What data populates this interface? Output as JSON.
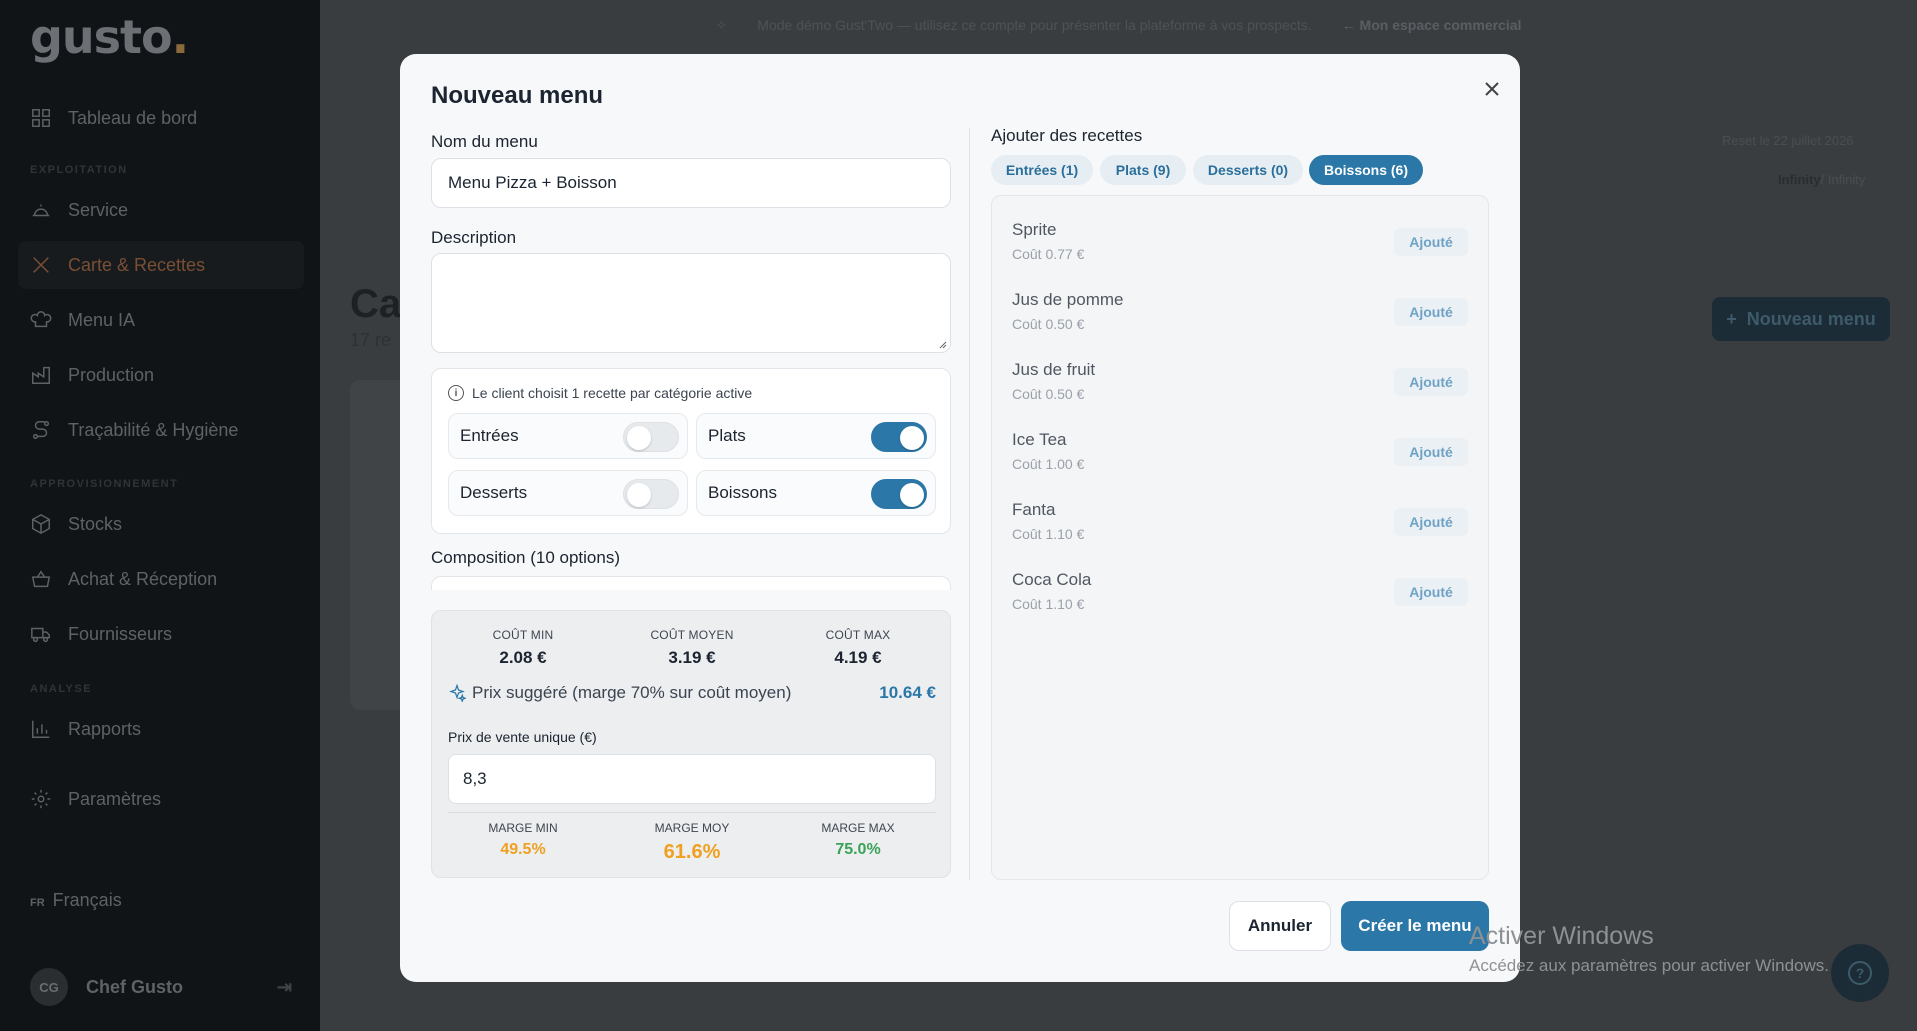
{
  "app": {
    "logo": "gusto",
    "topbar": {
      "notice": "Mode démo Gust'Two — utilisez ce compte pour présenter la plateforme à vos prospects.",
      "back_link": "← Mon espace commercial"
    },
    "sidebar": {
      "items": [
        {
          "label": "Tableau de bord",
          "icon": "grid-icon"
        },
        {
          "label": "Service",
          "icon": "cloche-icon"
        },
        {
          "label": "Carte & Recettes",
          "icon": "utensils-icon"
        },
        {
          "label": "Menu IA",
          "icon": "chef-hat-icon"
        },
        {
          "label": "Production",
          "icon": "factory-icon"
        },
        {
          "label": "Traçabilité & Hygiène",
          "icon": "route-icon"
        },
        {
          "label": "Stocks",
          "icon": "package-icon"
        },
        {
          "label": "Achat & Réception",
          "icon": "basket-icon"
        },
        {
          "label": "Fournisseurs",
          "icon": "truck-icon"
        },
        {
          "label": "Rapports",
          "icon": "chart-icon"
        },
        {
          "label": "Paramètres",
          "icon": "gear-icon"
        }
      ],
      "sections": [
        "EXPLOITATION",
        "APPROVISIONNEMENT",
        "ANALYSE"
      ],
      "language_code": "FR",
      "language": "Français",
      "user_initials": "CG",
      "user_name": "Chef Gusto"
    },
    "background": {
      "title": "Ca",
      "subtitle": "17 re",
      "reset_text": "Reset le 22 juillet 2026",
      "plan": "Infinity",
      "plan_suffix": "/ Infinity",
      "new_menu_button": "Nouveau menu"
    }
  },
  "modal": {
    "title": "Nouveau menu",
    "name_label": "Nom du menu",
    "name_value": "Menu Pizza + Boisson",
    "description_label": "Description",
    "description_value": "",
    "choice_info": "Le client choisit 1 recette par catégorie active",
    "categories": [
      {
        "label": "Entrées",
        "enabled": false
      },
      {
        "label": "Plats",
        "enabled": true
      },
      {
        "label": "Desserts",
        "enabled": false
      },
      {
        "label": "Boissons",
        "enabled": true
      }
    ],
    "composition_label": "Composition (10 options)",
    "stats": {
      "cout_min_label": "COÛT MIN",
      "cout_min": "2.08 €",
      "cout_moyen_label": "COÛT MOYEN",
      "cout_moyen": "3.19 €",
      "cout_max_label": "COÛT MAX",
      "cout_max": "4.19 €",
      "suggested_label": "Prix suggéré (marge 70% sur coût moyen)",
      "suggested_value": "10.64 €",
      "price_label": "Prix de vente unique (€)",
      "price_value": "8,3",
      "marge_min_label": "MARGE MIN",
      "marge_min": "49.5%",
      "marge_moy_label": "MARGE MOY",
      "marge_moy": "61.6%",
      "marge_max_label": "MARGE MAX",
      "marge_max": "75.0%"
    },
    "colors": {
      "accent": "#2a77a8",
      "marge_min": "#f0a020",
      "marge_moy": "#f0a020",
      "marge_max": "#3aa357"
    },
    "add_recipes_label": "Ajouter des recettes",
    "tabs": [
      {
        "label": "Entrées (1)",
        "active": false
      },
      {
        "label": "Plats (9)",
        "active": false
      },
      {
        "label": "Desserts (0)",
        "active": false
      },
      {
        "label": "Boissons (6)",
        "active": true
      }
    ],
    "recipes": [
      {
        "name": "Sprite",
        "cost": "Coût 0.77 €",
        "status": "Ajouté"
      },
      {
        "name": "Jus de pomme",
        "cost": "Coût 0.50 €",
        "status": "Ajouté"
      },
      {
        "name": "Jus de fruit",
        "cost": "Coût 0.50 €",
        "status": "Ajouté"
      },
      {
        "name": "Ice Tea",
        "cost": "Coût 1.00 €",
        "status": "Ajouté"
      },
      {
        "name": "Fanta",
        "cost": "Coût 1.10 €",
        "status": "Ajouté"
      },
      {
        "name": "Coca Cola",
        "cost": "Coût 1.10 €",
        "status": "Ajouté"
      }
    ],
    "cancel_label": "Annuler",
    "create_label": "Créer le menu"
  },
  "os": {
    "watermark_title": "Activer Windows",
    "watermark_sub": "Accédez aux paramètres pour activer Windows."
  }
}
